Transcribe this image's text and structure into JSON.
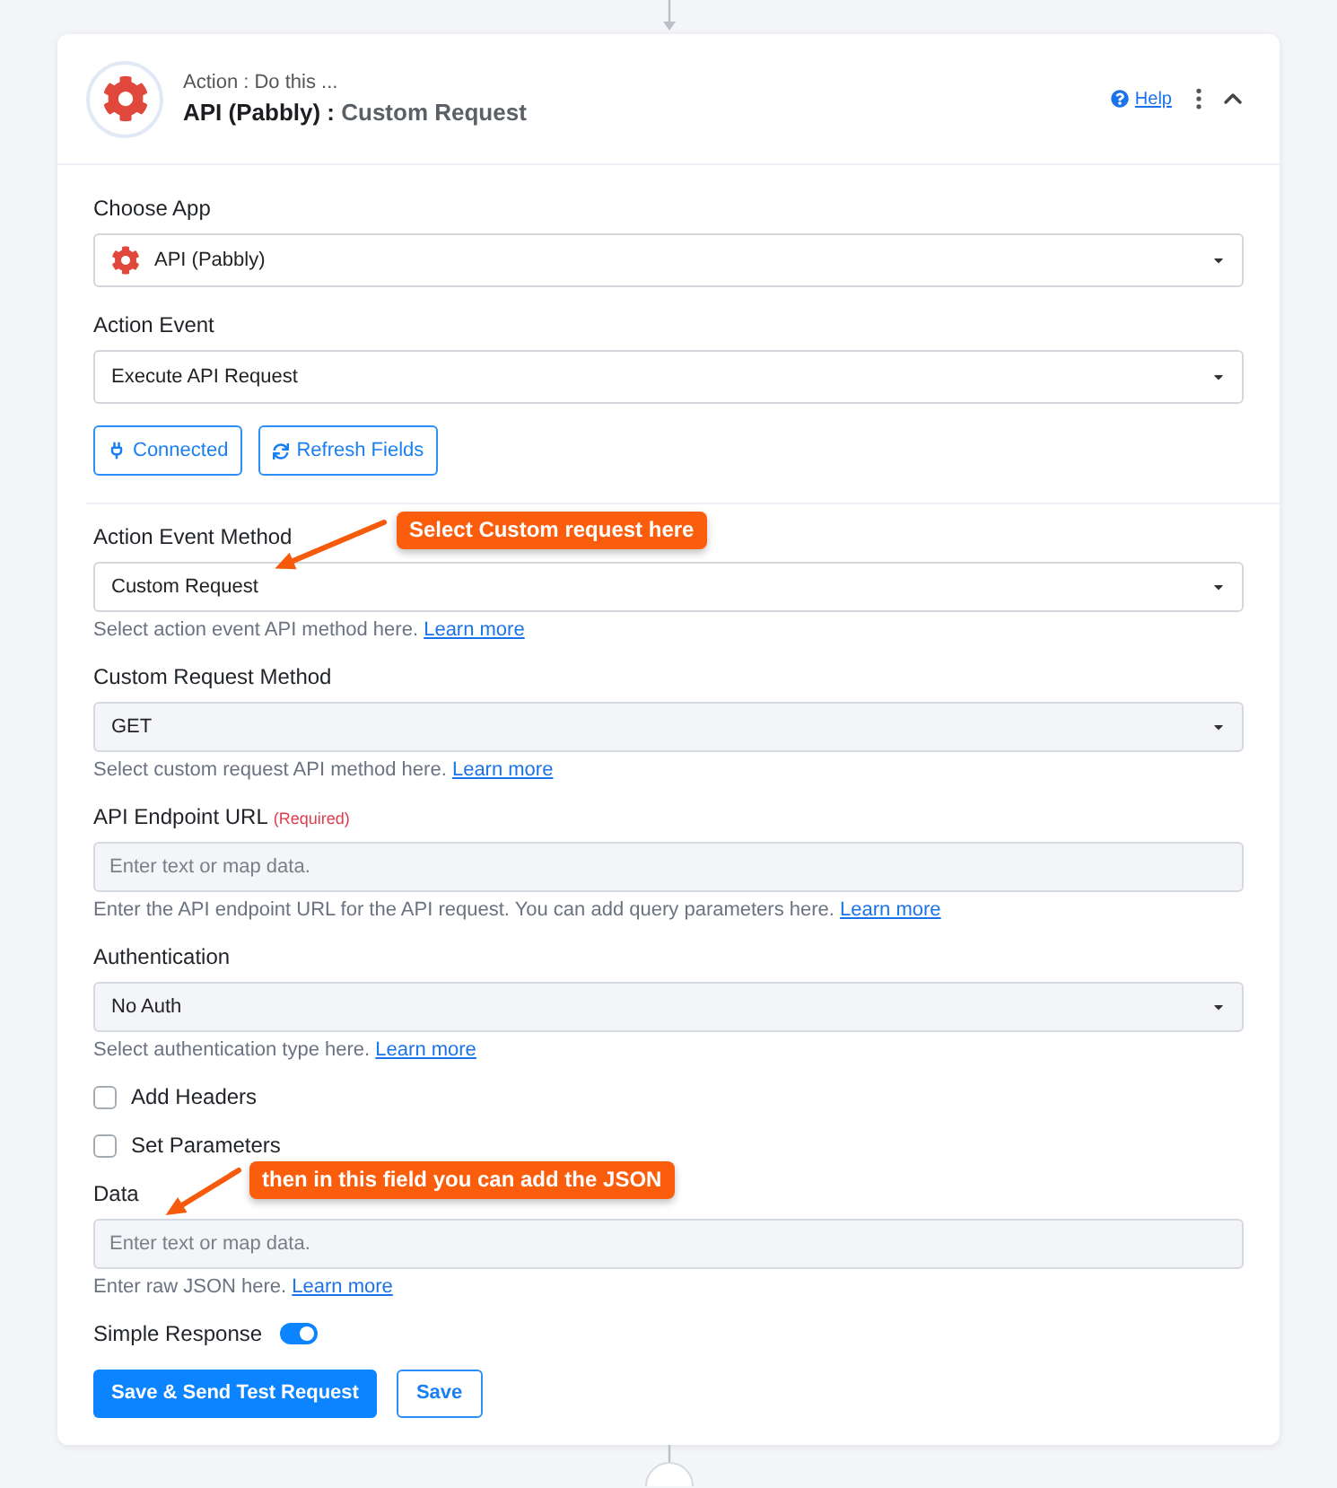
{
  "header": {
    "subtitle": "Action : Do this ...",
    "title": "**API (Pabbly) :** Custom Request",
    "help": "Help",
    "expanded": true
  },
  "app_fields": [
    {
      "kind": "app-select",
      "label": "Choose App",
      "value": "API (Pabbly)"
    },
    {
      "kind": "select",
      "label": "Action Event",
      "value": "Execute API Request"
    }
  ],
  "connection_buttons": [
    {
      "kind": "connection",
      "label": "Connected"
    },
    {
      "kind": "refresh",
      "label": "Refresh Fields"
    }
  ],
  "action_fields": [
    {
      "kind": "select",
      "label": "Action Event Method",
      "value": "Custom Request",
      "help": "Select action event API method here.",
      "link": "Learn more",
      "annotation": "Select Custom request here"
    },
    {
      "kind": "map-select",
      "label": "Custom Request Method",
      "value": "GET",
      "help": "Select custom request API method here.",
      "link": "Learn more"
    },
    {
      "kind": "map-input",
      "label": "API Endpoint URL",
      "required": "(Required)",
      "placeholder": "Enter text or map data.",
      "help": "Enter the API endpoint URL for the API request. You can add query parameters here.",
      "link": "Learn more"
    },
    {
      "kind": "map-select",
      "label": "Authentication",
      "value": "No Auth",
      "help": "Select authentication type here.",
      "link": "Learn more"
    },
    {
      "kind": "checkbox",
      "label": "Add Headers",
      "checked": false
    },
    {
      "kind": "checkbox",
      "label": "Set Parameters",
      "checked": false
    },
    {
      "kind": "map-input",
      "label": "Data",
      "placeholder": "Enter text or map data.",
      "help": "Enter raw JSON here.",
      "link": "Learn more",
      "annotation": "then in this field you can add the JSON"
    },
    {
      "kind": "toggle",
      "label": "Simple Response",
      "on": true
    }
  ],
  "actions": [
    {
      "kind": "primary",
      "label": "Save & Send Test Request"
    },
    {
      "kind": "outline",
      "label": "Save"
    }
  ]
}
